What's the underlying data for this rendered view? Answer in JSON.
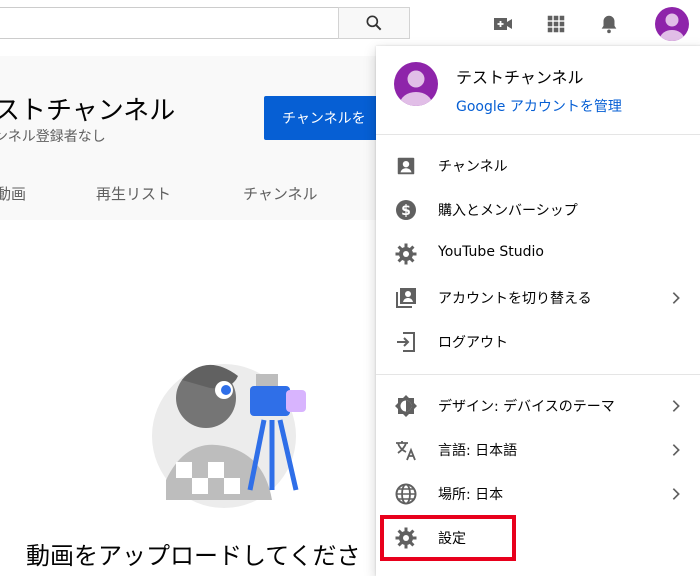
{
  "search": {
    "placeholder": "",
    "value": ""
  },
  "topbar": {
    "icons": [
      "search-icon",
      "video-camera-plus-icon",
      "apps-grid-icon",
      "bell-icon",
      "avatar"
    ]
  },
  "channel": {
    "name": "ストチャンネル",
    "subscribers": "ンネル登録者なし",
    "customize_button": "チャンネルを",
    "tabs": [
      "動画",
      "再生リスト",
      "チャンネル"
    ]
  },
  "empty_state": {
    "text": "動画をアップロードしてくださ"
  },
  "account_menu": {
    "user_name": "テストチャンネル",
    "manage_account": "Google アカウントを管理",
    "items": [
      {
        "label": "チャンネル",
        "icon": "account-box-icon",
        "chevron": false
      },
      {
        "label": "購入とメンバーシップ",
        "icon": "dollar-circle-icon",
        "chevron": false
      },
      {
        "label": "YouTube Studio",
        "icon": "gear-icon",
        "chevron": false
      },
      {
        "label": "アカウントを切り替える",
        "icon": "switch-account-icon",
        "chevron": true
      },
      {
        "label": "ログアウト",
        "icon": "logout-icon",
        "chevron": false
      },
      {
        "label": "デザイン: デバイスのテーマ",
        "icon": "theme-icon",
        "chevron": true
      },
      {
        "label": "言語: 日本語",
        "icon": "translate-icon",
        "chevron": true
      },
      {
        "label": "場所: 日本",
        "icon": "globe-icon",
        "chevron": true
      },
      {
        "label": "設定",
        "icon": "settings-gear-icon",
        "chevron": false
      }
    ]
  },
  "colors": {
    "accent_blue": "#065fd4",
    "avatar_purple": "#8e24aa",
    "highlight_red": "#e8001c",
    "icon_gray": "#606060"
  }
}
